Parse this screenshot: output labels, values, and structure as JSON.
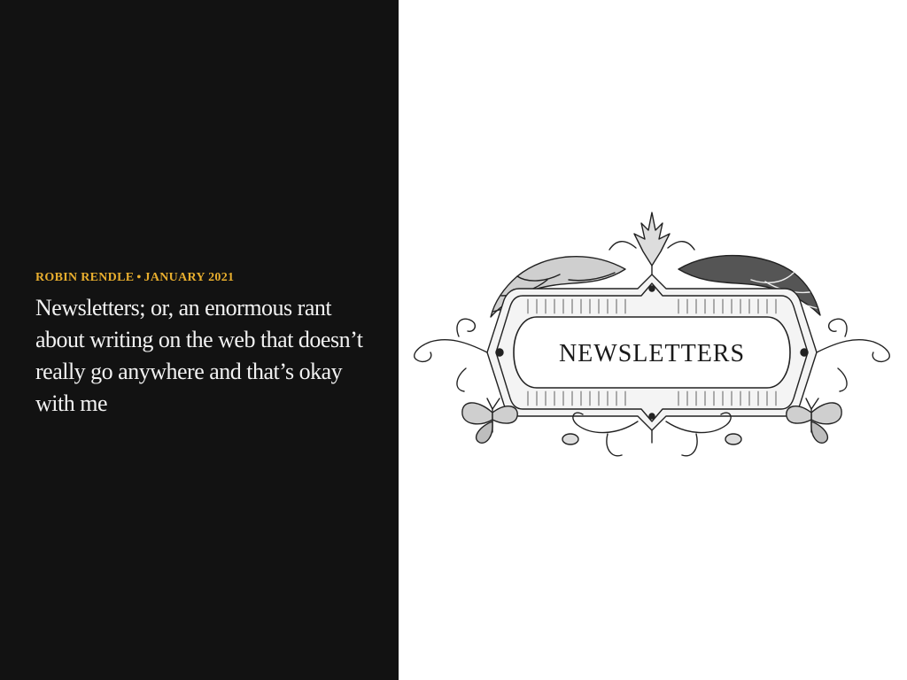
{
  "article": {
    "author": "ROBIN RENDLE",
    "separator": "•",
    "date": "JANUARY 2021",
    "title": "Newsletters; or, an enormous rant about writing on the web that doesn’t really go anywhere and that’s okay with me"
  },
  "illustration": {
    "label": "NEWSLETTERS",
    "icon": "ornamental-banner-icon"
  },
  "colors": {
    "left_panel_bg": "#121212",
    "byline": "#e8ae2e",
    "title": "#f2f2f2",
    "right_panel_bg": "#ffffff"
  }
}
